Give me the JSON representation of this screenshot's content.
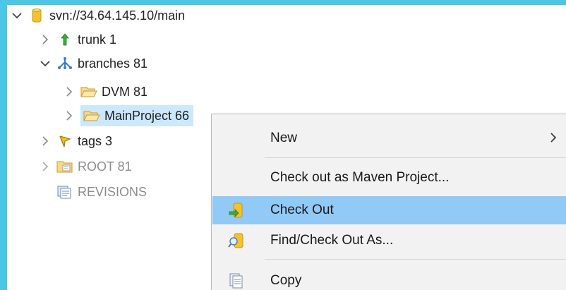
{
  "tree": {
    "root": {
      "label": "svn://34.64.145.10/main"
    },
    "trunk": {
      "label": "trunk 1"
    },
    "branches": {
      "label": "branches 81"
    },
    "dvm": {
      "label": "DVM 81"
    },
    "mainproject": {
      "label": "MainProject 66"
    },
    "tags": {
      "label": "tags 3"
    },
    "root_folder": {
      "label": "ROOT 81"
    },
    "revisions": {
      "label": "REVISIONS"
    }
  },
  "context_menu": {
    "items": [
      {
        "label": "New",
        "submenu": true
      },
      {
        "label": "Check out as Maven Project..."
      },
      {
        "label": "Check Out",
        "highlighted": true
      },
      {
        "label": "Find/Check Out As..."
      },
      {
        "label": "Copy"
      }
    ]
  },
  "colors": {
    "background_frame": "#4cc6e6",
    "selection": "#cce8ff",
    "menu_hover": "#91c9f7",
    "menu_bg": "#f2f2f2"
  }
}
